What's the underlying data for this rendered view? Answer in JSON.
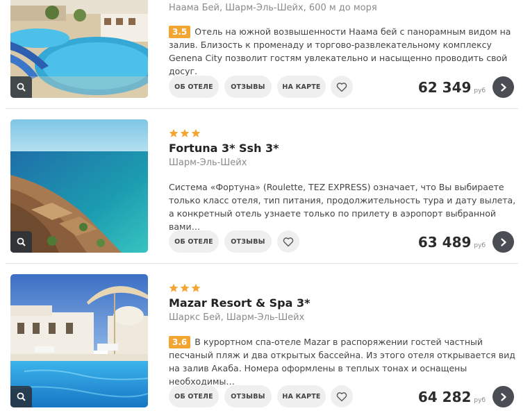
{
  "hotels": [
    {
      "name": "",
      "stars": 0,
      "location": "Наама Бей, Шарм-Эль-Шейх, 600 м до моря",
      "rating": "3.5",
      "description": "Отель на южной возвышенности Наама бей с панорамным видом на залив. Близость к променаду и торгово-развлекательному комплексу Genena City позволит гостям увлекательно и насыщенно проводить свой досуг.",
      "buttons": {
        "about": "ОБ ОТЕЛЕ",
        "reviews": "ОТЗЫВЫ",
        "map": "НА КАРТЕ"
      },
      "price": "62 349",
      "currency": "руб",
      "photo_icon": "search-icon"
    },
    {
      "name": "Fortuna 3* Ssh 3*",
      "stars": 3,
      "location": "Шарм-Эль-Шейх",
      "rating": "",
      "description": "Система «Фортуна» (Roulette, TEZ EXPRESS) означает, что Вы выбираете только класс отеля, тип питания, продолжительность тура и дату вылета, а конкретный отель узнаете только по прилету в аэропорт выбранной вами…",
      "buttons": {
        "about": "ОБ ОТЕЛЕ",
        "reviews": "ОТЗЫВЫ"
      },
      "price": "63 489",
      "currency": "руб",
      "photo_icon": "search-icon"
    },
    {
      "name": "Mazar Resort & Spa 3*",
      "stars": 3,
      "location": "Шаркс Бей, Шарм-Эль-Шейх",
      "rating": "3.6",
      "description": "В курортном спа-отеле Mazar в распоряжении гостей частный песчаный пляж и два открытых бассейна. Из этого отеля открывается вид на залив Акаба. Номера оформлены в теплых тонах и оснащены необходимы…",
      "buttons": {
        "about": "ОБ ОТЕЛЕ",
        "reviews": "ОТЗЫВЫ",
        "map": "НА КАРТЕ"
      },
      "price": "64 282",
      "currency": "руб",
      "photo_icon": "search-icon"
    }
  ],
  "colors": {
    "star": "#f3a531",
    "rating_badge": "#f3a531",
    "go_button": "#4a4d54",
    "pill_button": "#efefef",
    "divider": "#e2e2e2"
  },
  "icons": {
    "star": "star-icon",
    "favorite": "heart-icon",
    "go": "chevron-right-icon",
    "zoom": "search-icon"
  }
}
